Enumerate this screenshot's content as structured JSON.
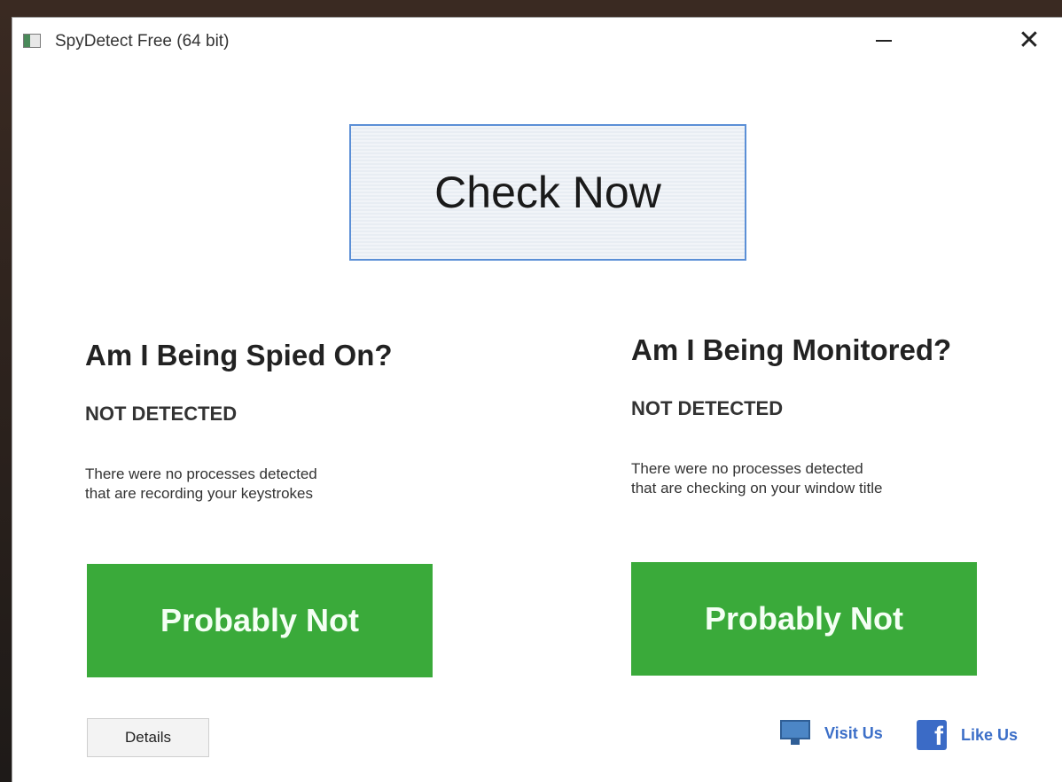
{
  "window": {
    "title": "SpyDetect Free (64 bit)",
    "minimize_symbol": "–",
    "close_symbol": "✕"
  },
  "check_button": {
    "label": "Check Now"
  },
  "spied_panel": {
    "title": "Am I Being Spied On?",
    "status": "NOT DETECTED",
    "description_line1": "There were no processes detected",
    "description_line2": "that are recording your keystrokes",
    "result_label": "Probably Not"
  },
  "monitored_panel": {
    "title": "Am I Being Monitored?",
    "status": "NOT DETECTED",
    "description_line1": "There were no processes detected",
    "description_line2": "that are checking on your window title",
    "result_label": "Probably Not"
  },
  "footer": {
    "details_label": "Details",
    "visit_label": "Visit Us",
    "like_label": "Like Us",
    "facebook_glyph": "f"
  },
  "colors": {
    "result_green": "#3aaa3a",
    "link_blue": "#3c6fc8",
    "check_border": "#5b8fd6"
  }
}
